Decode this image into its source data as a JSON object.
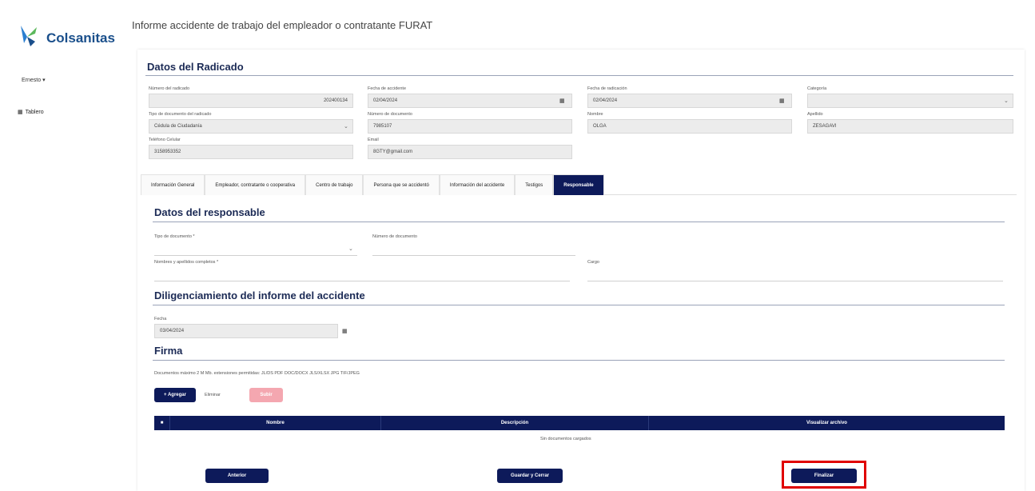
{
  "brand": {
    "name": "Colsanitas",
    "tagline": ""
  },
  "sidebar": {
    "user_menu": "Ernesto ▾",
    "nav_item": "Tablero"
  },
  "page": {
    "title": "Informe accidente de trabajo del empleador o contratante FURAT"
  },
  "radicado": {
    "title": "Datos del Radicado",
    "fields": [
      {
        "label": "Número del radicado",
        "value": "202400134"
      },
      {
        "label": "Fecha de accidente",
        "value": "02/04/2024"
      },
      {
        "label": "Fecha de radicación",
        "value": "02/04/2024"
      },
      {
        "label": "Categoría",
        "value": ""
      },
      {
        "label": "Tipo de documento del radicado",
        "value": "Cédula de Ciudadanía"
      },
      {
        "label": "Número de documento",
        "value": "7985107"
      },
      {
        "label": "Nombre",
        "value": "OLGA"
      },
      {
        "label": "Apellido",
        "value": "ZESAGAVI"
      },
      {
        "label": "Teléfono Celular",
        "value": "3158953352"
      },
      {
        "label": "Email",
        "value": "8GTY@gmail.com"
      }
    ]
  },
  "tabs": [
    {
      "label": "Información General",
      "active": false
    },
    {
      "label": "Empleador, contratante o cooperativa",
      "active": false
    },
    {
      "label": "Centro de trabajo",
      "active": false
    },
    {
      "label": "Persona que se accidentó",
      "active": false
    },
    {
      "label": "Información del accidente",
      "active": false
    },
    {
      "label": "Testigos",
      "active": false
    },
    {
      "label": "Responsable",
      "active": true
    }
  ],
  "responsable": {
    "title": "Datos del responsable",
    "tipo_documento_label": "Tipo de documento *",
    "numero_documento_label": "Número de documento",
    "nombre_label": "Nombres y apellidos completos *",
    "cargo_label": "Cargo"
  },
  "diligenciamiento": {
    "title": "Diligenciamiento del informe del accidente",
    "fecha_label": "Fecha",
    "fecha_value": "03/04/2024"
  },
  "firma": {
    "title": "Firma",
    "help_text": "Documentos máximo 2 M Mb. extensiones permitidas: JL/DS PDF DOC/DOCX JLS/XLSX JPG TIF/JPEG",
    "add_button": "+ Agregar",
    "remove_label": "Eliminar",
    "upload_button": "Subir",
    "columns": [
      "Nombre",
      "Descripción",
      "Visualizar archivo"
    ],
    "empty_text": "Sin documentos cargados"
  },
  "actions": {
    "previous": "Anterior",
    "save_close": "Guardar y Cerrar",
    "finish": "Finalizar"
  },
  "colors": {
    "primary": "#0d1a5a",
    "highlight": "#e00000",
    "disabled": "#f4a7b0"
  }
}
